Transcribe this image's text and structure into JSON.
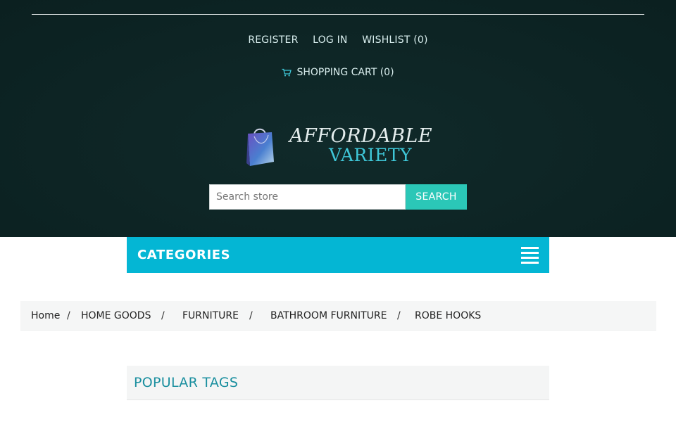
{
  "header": {
    "links": {
      "register": "REGISTER",
      "login": "LOG IN",
      "wishlist": "WISHLIST (0)",
      "cart": "SHOPPING CART (0)"
    },
    "logo": {
      "line1": "AFFORDABLE",
      "line2": "VARIETY"
    },
    "search": {
      "placeholder": "Search store",
      "button": "SEARCH"
    }
  },
  "categories": {
    "title": "CATEGORIES"
  },
  "breadcrumb": {
    "items": [
      "Home",
      "HOME GOODS",
      "FURNITURE",
      "BATHROOM FURNITURE",
      "ROBE HOOKS"
    ],
    "separator": "/"
  },
  "popular_tags": {
    "title": "POPULAR TAGS"
  },
  "colors": {
    "header_bg": "#0d2424",
    "accent_cyan": "#04b6d4",
    "search_button": "#2bc7b7",
    "heading_teal": "#1a8f9f"
  },
  "icons": {
    "cart": "cart-icon",
    "menu": "hamburger-menu-icon",
    "logo": "shopping-bag-logo-icon"
  }
}
